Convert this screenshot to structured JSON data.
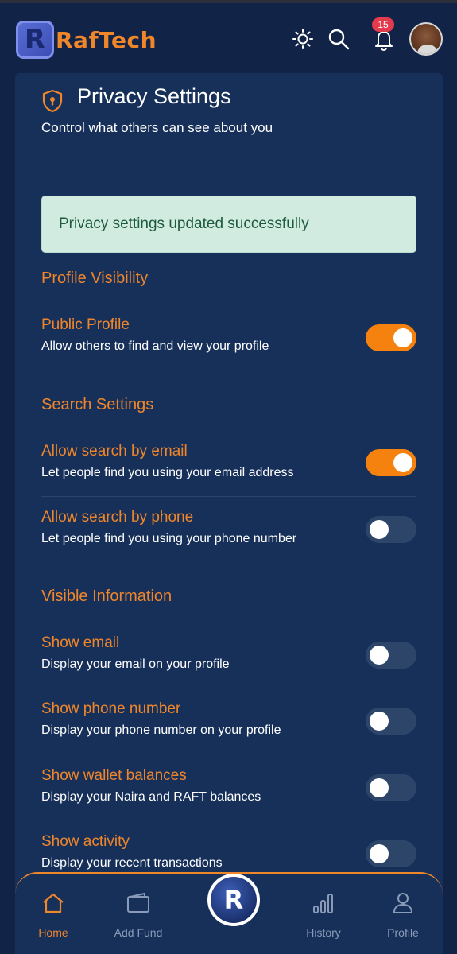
{
  "header": {
    "brand": "RafTech",
    "logo_letter": "R",
    "notification_count": "15",
    "icons": [
      "sun-icon",
      "search-icon",
      "bell-icon"
    ]
  },
  "privacy": {
    "title": "Privacy Settings",
    "subtitle": "Control what others can see about you",
    "alert": "Privacy settings updated successfully"
  },
  "sections": {
    "profile_visibility": {
      "title": "Profile Visibility",
      "public_profile": {
        "label": "Public Profile",
        "desc": "Allow others to find and view your profile",
        "enabled": true
      }
    },
    "search_settings": {
      "title": "Search Settings",
      "search_email": {
        "label": "Allow search by email",
        "desc": "Let people find you using your email address",
        "enabled": true
      },
      "search_phone": {
        "label": "Allow search by phone",
        "desc": "Let people find you using your phone number",
        "enabled": false
      }
    },
    "visible_information": {
      "title": "Visible Information",
      "show_email": {
        "label": "Show email",
        "desc": "Display your email on your profile",
        "enabled": false
      },
      "show_phone": {
        "label": "Show phone number",
        "desc": "Display your phone number on your profile",
        "enabled": false
      },
      "show_wallet": {
        "label": "Show wallet balances",
        "desc": "Display your Naira and RAFT balances",
        "enabled": false
      },
      "show_activity": {
        "label": "Show activity",
        "desc": "Display your recent transactions",
        "enabled": false
      }
    }
  },
  "bottom_nav": {
    "home": "Home",
    "add_fund": "Add Fund",
    "center_letter": "R",
    "history": "History",
    "profile": "Profile",
    "active": "home"
  },
  "colors": {
    "background": "#112447",
    "card": "#17305a",
    "accent": "#f0862a",
    "toggle_on": "#f5820f",
    "toggle_off": "#2c4569",
    "alert_bg": "#d1ebe1",
    "alert_text": "#1d5a3e",
    "badge": "#e23b4e"
  }
}
